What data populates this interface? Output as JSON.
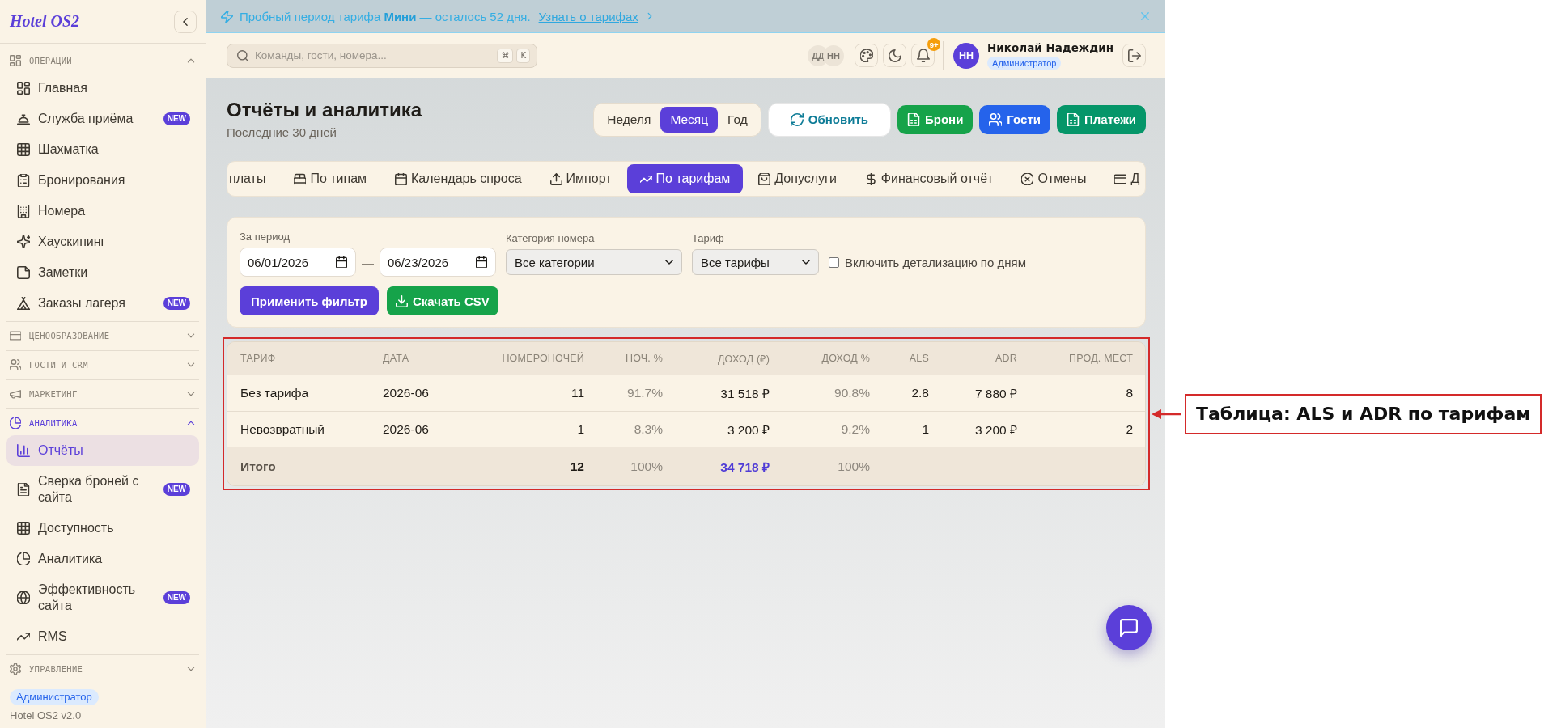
{
  "sidebar": {
    "logo": "Hotel OS2",
    "sections": [
      {
        "title": "ОПЕРАЦИИ",
        "expanded": true,
        "active": false,
        "items": [
          {
            "label": "Главная",
            "selected": false
          },
          {
            "label": "Служба приёма",
            "badge": "NEW",
            "selected": false
          },
          {
            "label": "Шахматка",
            "selected": false
          },
          {
            "label": "Бронирования",
            "selected": false
          },
          {
            "label": "Номера",
            "selected": false
          },
          {
            "label": "Хаускипинг",
            "selected": false
          },
          {
            "label": "Заметки",
            "selected": false
          },
          {
            "label": "Заказы лагеря",
            "badge": "NEW",
            "selected": false
          }
        ]
      },
      {
        "title": "ЦЕНООБРАЗОВАНИЕ",
        "expanded": false,
        "active": false
      },
      {
        "title": "ГОСТИ И CRM",
        "expanded": false,
        "active": false
      },
      {
        "title": "МАРКЕТИНГ",
        "expanded": false,
        "active": false
      },
      {
        "title": "АНАЛИТИКА",
        "expanded": true,
        "active": true,
        "items": [
          {
            "label": "Отчёты",
            "selected": true
          },
          {
            "label": "Сверка броней с сайта",
            "badge": "NEW",
            "selected": false
          },
          {
            "label": "Доступность",
            "selected": false
          },
          {
            "label": "Аналитика",
            "selected": false
          },
          {
            "label": "Эффективность сайта",
            "badge": "NEW",
            "selected": false
          },
          {
            "label": "RMS",
            "selected": false
          }
        ]
      },
      {
        "title": "УПРАВЛЕНИЕ",
        "expanded": false,
        "active": false
      }
    ],
    "footer": {
      "role": "Администратор",
      "version": "Hotel OS2 v2.0"
    }
  },
  "banner": {
    "text": "Пробный период тарифа **Мини** — осталось 52 дня.",
    "link": "Узнать о тарифах"
  },
  "header": {
    "search": {
      "placeholder": "Команды, гости, номера...",
      "keys": [
        "⌘",
        "K"
      ]
    },
    "online_users": [
      "ДД",
      "НН"
    ],
    "notifications_badge": "9+",
    "user": {
      "initials": "НН",
      "name": "Николай Надеждин",
      "role": "Администратор"
    }
  },
  "page": {
    "title": "Отчёты и аналитика",
    "subtitle": "Последние 30 дней",
    "periods": [
      {
        "label": "Неделя",
        "selected": false
      },
      {
        "label": "Месяц",
        "selected": true
      },
      {
        "label": "Год",
        "selected": false
      }
    ],
    "actions": [
      {
        "label": "Обновить",
        "kind": "outline",
        "color": "#0e7c97"
      },
      {
        "label": "Брони",
        "kind": "solid",
        "color": "#16a34a"
      },
      {
        "label": "Гости",
        "kind": "solid",
        "color": "#2563eb"
      },
      {
        "label": "Платежи",
        "kind": "solid",
        "color": "#059669"
      }
    ]
  },
  "report_tabs": [
    {
      "label": "платы",
      "selected": false
    },
    {
      "label": "По типам",
      "selected": false
    },
    {
      "label": "Календарь спроса",
      "selected": false
    },
    {
      "label": "Импорт",
      "selected": false
    },
    {
      "label": "По тарифам",
      "selected": true
    },
    {
      "label": "Допуслуги",
      "selected": false
    },
    {
      "label": "Финансовый отчёт",
      "selected": false
    },
    {
      "label": "Отмены",
      "selected": false
    },
    {
      "label": "Д",
      "selected": false
    }
  ],
  "filter": {
    "period": {
      "label": "За период",
      "from": "06/01/2026",
      "separator": "—",
      "to": "06/23/2026"
    },
    "category": {
      "label": "Категория номера",
      "value": "Все категории"
    },
    "rate": {
      "label": "Тариф",
      "value": "Все тарифы"
    },
    "daily_detail": {
      "label": "Включить детализацию по дням",
      "checked": false
    },
    "buttons": [
      {
        "label": "Применить фильтр",
        "kind": "primary"
      },
      {
        "label": "Скачать CSV",
        "kind": "export"
      }
    ]
  },
  "table": {
    "columns": [
      "ТАРИФ",
      "ДАТА",
      "НОМЕРОНОЧЕЙ",
      "НОЧ. %",
      "ДОХОД (₽)",
      "ДОХОД %",
      "ALS",
      "ADR",
      "ПРОД. МЕСТ"
    ],
    "rows": [
      {
        "cells": [
          "Без тарифа",
          "2026-06",
          "11",
          "91.7%",
          "31 518 ₽",
          "90.8%",
          "2.8",
          "7 880 ₽",
          "8"
        ]
      },
      {
        "cells": [
          "Невозвратный",
          "2026-06",
          "1",
          "8.3%",
          "3 200 ₽",
          "9.2%",
          "1",
          "3 200 ₽",
          "2"
        ]
      }
    ],
    "total": {
      "cells": [
        "Итого",
        null,
        "12",
        "100%",
        "34 718 ₽",
        "100%",
        null,
        null,
        null
      ]
    }
  },
  "annotation": {
    "label": "Таблица: ALS и ADR по тарифам"
  }
}
